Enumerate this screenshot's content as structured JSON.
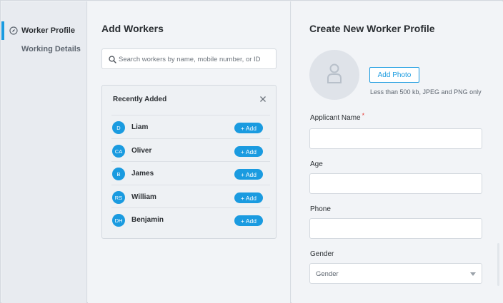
{
  "sidebar": {
    "items": [
      {
        "label": "Worker Profile",
        "active": true,
        "icon": "compass-icon"
      },
      {
        "label": "Working Details",
        "active": false
      }
    ]
  },
  "add_workers": {
    "title": "Add Workers",
    "search": {
      "placeholder": "Search workers by name, mobile number, or ID",
      "value": ""
    },
    "recent": {
      "title": "Recently Added",
      "add_label": "+ Add",
      "workers": [
        {
          "initials": "D",
          "name": "Liam"
        },
        {
          "initials": "CA",
          "name": "Oliver"
        },
        {
          "initials": "B",
          "name": "James"
        },
        {
          "initials": "RS",
          "name": "William"
        },
        {
          "initials": "DH",
          "name": "Benjamin"
        }
      ]
    }
  },
  "profile_form": {
    "title": "Create New Worker Profile",
    "add_photo_label": "Add Photo",
    "photo_hint": "Less than 500 kb, JPEG and PNG only",
    "fields": {
      "applicant_name": {
        "label": "Applicant Name",
        "required_mark": "*",
        "value": ""
      },
      "age": {
        "label": "Age",
        "value": ""
      },
      "phone": {
        "label": "Phone",
        "value": ""
      },
      "gender": {
        "label": "Gender",
        "selected": "Gender"
      }
    }
  },
  "colors": {
    "accent": "#1a9be0",
    "required": "#e53935",
    "sidebar_bg": "#e8ebf0",
    "panel_bg": "#f2f4f7"
  }
}
